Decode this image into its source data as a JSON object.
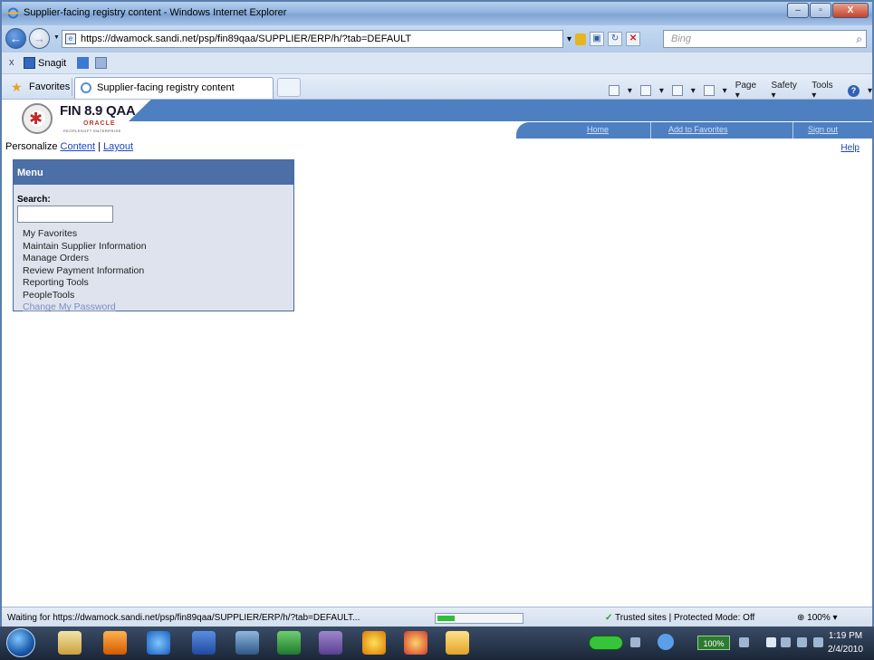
{
  "window": {
    "title": "Supplier-facing registry content - Windows Internet Explorer",
    "buttons": [
      "–",
      "▫",
      "X"
    ]
  },
  "address_bar": {
    "url": "https://dwamock.sandi.net/psp/fin89qaa/SUPPLIER/ERP/h/?tab=DEFAULT",
    "search_placeholder": "Bing"
  },
  "snagit_bar": {
    "close": "x",
    "label": "Snagit"
  },
  "favorites_bar": {
    "favorites_label": "Favorites",
    "tab_title": "Supplier-facing registry content",
    "commands": [
      "Page ▾",
      "Safety ▾",
      "Tools ▾"
    ]
  },
  "peoplesoft": {
    "logo_title": "FIN 8.9 QAA",
    "logo_oracle": "ORACLE",
    "logo_pse": "PEOPLESOFT ENTERPRISE",
    "nav_links": [
      "Home",
      "Add to Favorites",
      "Sign out"
    ],
    "personalize_label": "Personalize",
    "content_link": "Content",
    "separator": "|",
    "layout_link": "Layout",
    "help_link": "Help"
  },
  "menu": {
    "title": "Menu",
    "search_label": "Search:",
    "search_value": "",
    "items": [
      "My Favorites",
      "Maintain Supplier Information",
      "Manage Orders",
      "Review Payment Information",
      "Reporting Tools",
      "PeopleTools",
      "Change My Password"
    ]
  },
  "status_bar": {
    "text": "Waiting for https://dwamock.sandi.net/psp/fin89qaa/SUPPLIER/ERP/h/?tab=DEFAULT...",
    "progress": 0.2,
    "zone": "Trusted sites | Protected Mode: Off",
    "zoom": "100%"
  },
  "taskbar": {
    "battery_percent": "100%",
    "time": "1:19 PM",
    "date": "2/4/2010"
  },
  "colors": {
    "ps_blue": "#4e80c1",
    "menu_header": "#4b6fa6",
    "link": "#1a46c8"
  }
}
